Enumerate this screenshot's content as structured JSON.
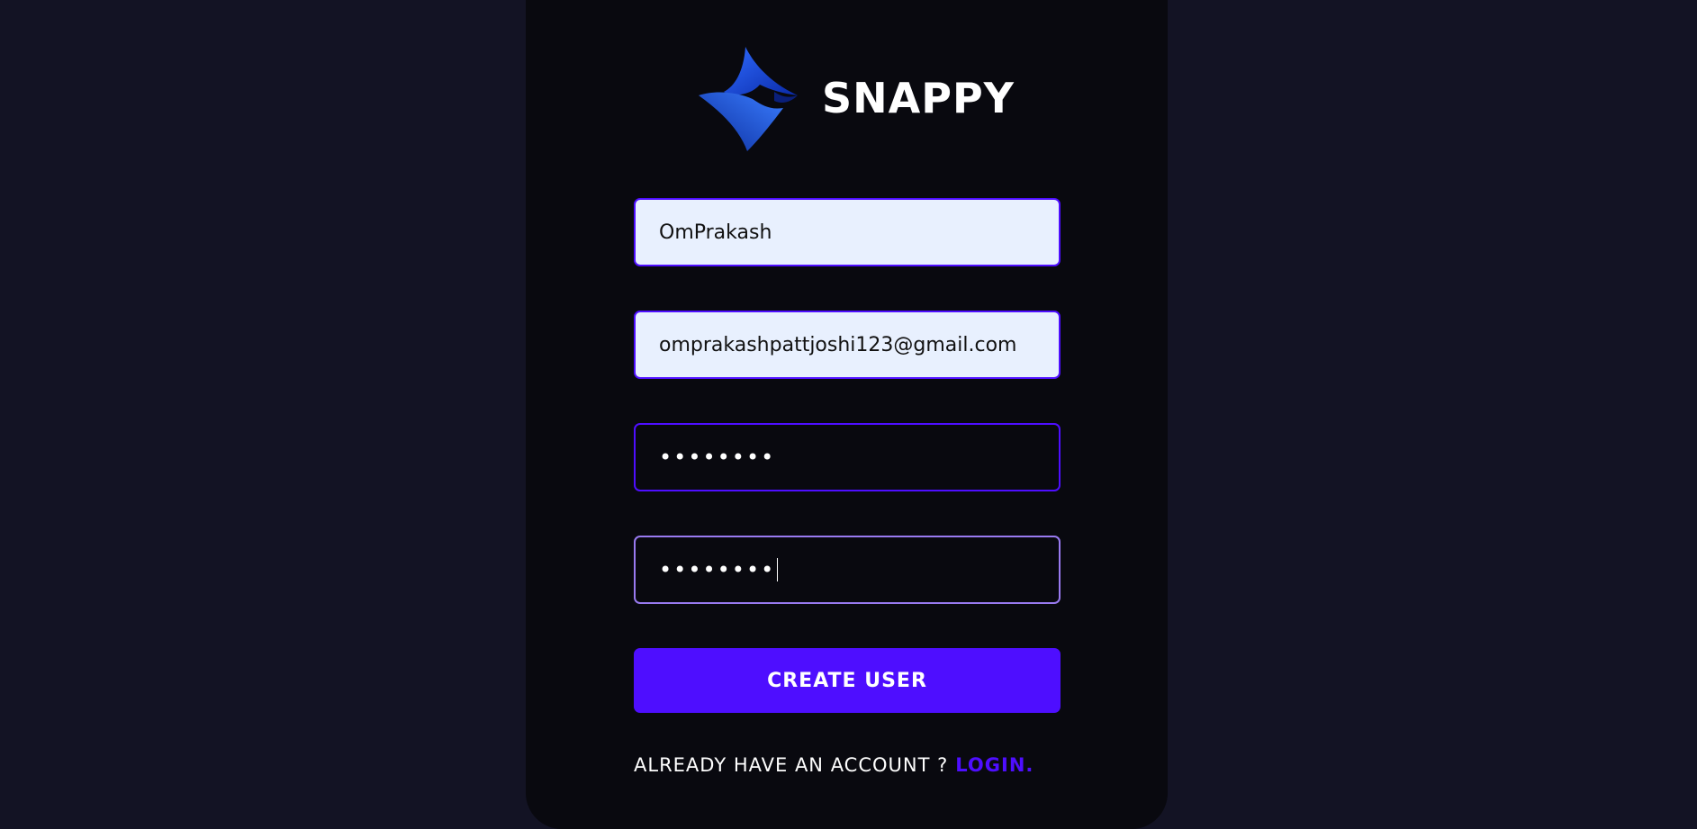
{
  "brand": {
    "logo_icon": "snappy-logo-icon",
    "title": "SNAPPY"
  },
  "form": {
    "username": {
      "value": "OmPrakash"
    },
    "email": {
      "value": "omprakashpattjoshi123@gmail.com"
    },
    "password": {
      "masked_value": "••••••••"
    },
    "confirm_password": {
      "masked_value": "••••••••"
    },
    "submit_label": "CREATE USER"
  },
  "footer": {
    "prompt": "ALREADY HAVE AN ACCOUNT ?",
    "link_label": "LOGIN."
  },
  "colors": {
    "page_background": "#131324",
    "card_background": "#09090f",
    "accent": "#4e0eff",
    "focus_border": "#997af0",
    "autofill_background": "#e8f0fe"
  }
}
